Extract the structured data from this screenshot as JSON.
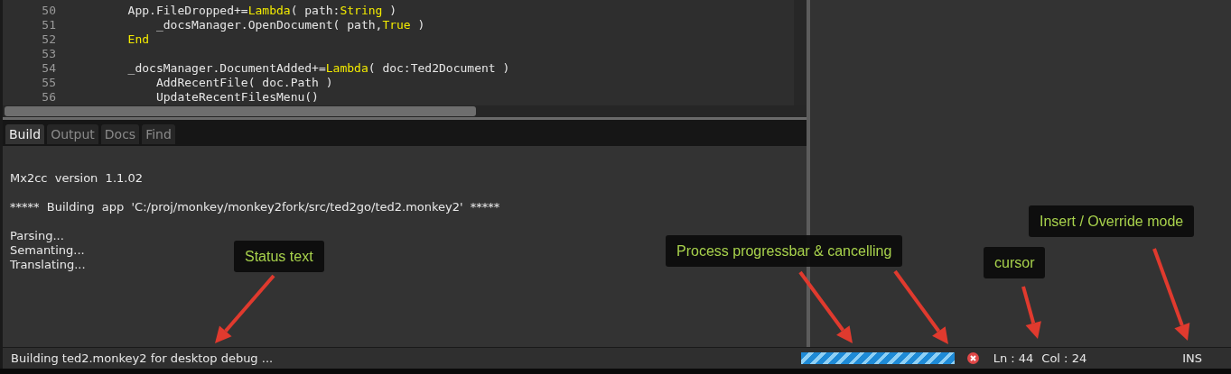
{
  "editor": {
    "lines": [
      {
        "number": "50",
        "segments": [
          {
            "text": "        App.FileDropped+=",
            "kind": "plain"
          },
          {
            "text": "Lambda",
            "kind": "keyword"
          },
          {
            "text": "( path:",
            "kind": "plain"
          },
          {
            "text": "String",
            "kind": "keyword"
          },
          {
            "text": " )",
            "kind": "plain"
          }
        ]
      },
      {
        "number": "51",
        "segments": [
          {
            "text": "            _docsManager.OpenDocument( path,",
            "kind": "plain"
          },
          {
            "text": "True",
            "kind": "keyword"
          },
          {
            "text": " )",
            "kind": "plain"
          }
        ]
      },
      {
        "number": "52",
        "segments": [
          {
            "text": "        End",
            "kind": "keyword"
          }
        ]
      },
      {
        "number": "53"
      },
      {
        "number": "54",
        "segments": [
          {
            "text": "        _docsManager.DocumentAdded+=",
            "kind": "plain"
          },
          {
            "text": "Lambda",
            "kind": "keyword"
          },
          {
            "text": "( doc:Ted2Document )",
            "kind": "plain"
          }
        ]
      },
      {
        "number": "55",
        "segments": [
          {
            "text": "            AddRecentFile( doc.Path )",
            "kind": "plain"
          }
        ]
      },
      {
        "number": "56",
        "segments": [
          {
            "text": "            UpdateRecentFilesMenu()",
            "kind": "plain"
          }
        ]
      }
    ]
  },
  "console": {
    "tabs": [
      {
        "label": "Build",
        "selected": true
      },
      {
        "label": "Output",
        "selected": false
      },
      {
        "label": "Docs",
        "selected": false
      },
      {
        "label": "Find",
        "selected": false
      }
    ],
    "output_blocks": [
      [
        "Mx2cc  version  1.1.02"
      ],
      [
        "*****  Building  app  'C:/proj/monkey/monkey2fork/src/ted2go/ted2.monkey2'  *****"
      ],
      [
        "Parsing...",
        "Semanting...",
        "Translating..."
      ]
    ]
  },
  "status_bar": {
    "text": "Building ted2.monkey2 for desktop debug ...",
    "cursor_line": "Ln : 44",
    "cursor_column": "Col : 24",
    "mode": "INS"
  },
  "annotations": [
    {
      "text": "Status text"
    },
    {
      "text": "Process progressbar & cancelling"
    },
    {
      "text": "cursor"
    },
    {
      "text": "Insert / Override mode"
    }
  ]
}
